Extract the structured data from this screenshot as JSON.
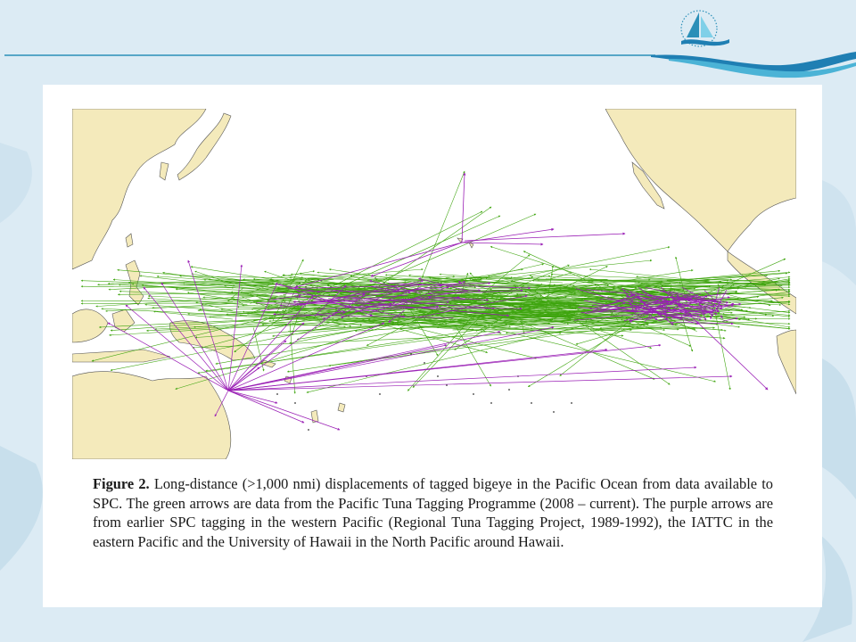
{
  "slide": {
    "caption": {
      "label": "Figure 2.",
      "text": " Long-distance (>1,000 nmi) displacements of tagged bigeye in the Pacific Ocean from data available to SPC. The green arrows are data from the Pacific Tuna Tagging Programme (2008 – current). The purple arrows are from earlier SPC tagging in the western Pacific (Regional Tuna Tagging Project, 1989-1992), the IATTC in the eastern Pacific and the University of Hawaii in the North Pacific around Hawaii."
    }
  },
  "legend_colors": {
    "green_arrows": "#3fa50f",
    "purple_arrows": "#9a1fb5",
    "land": "#f4eabb",
    "brand_teal": "#1e9fc2"
  }
}
